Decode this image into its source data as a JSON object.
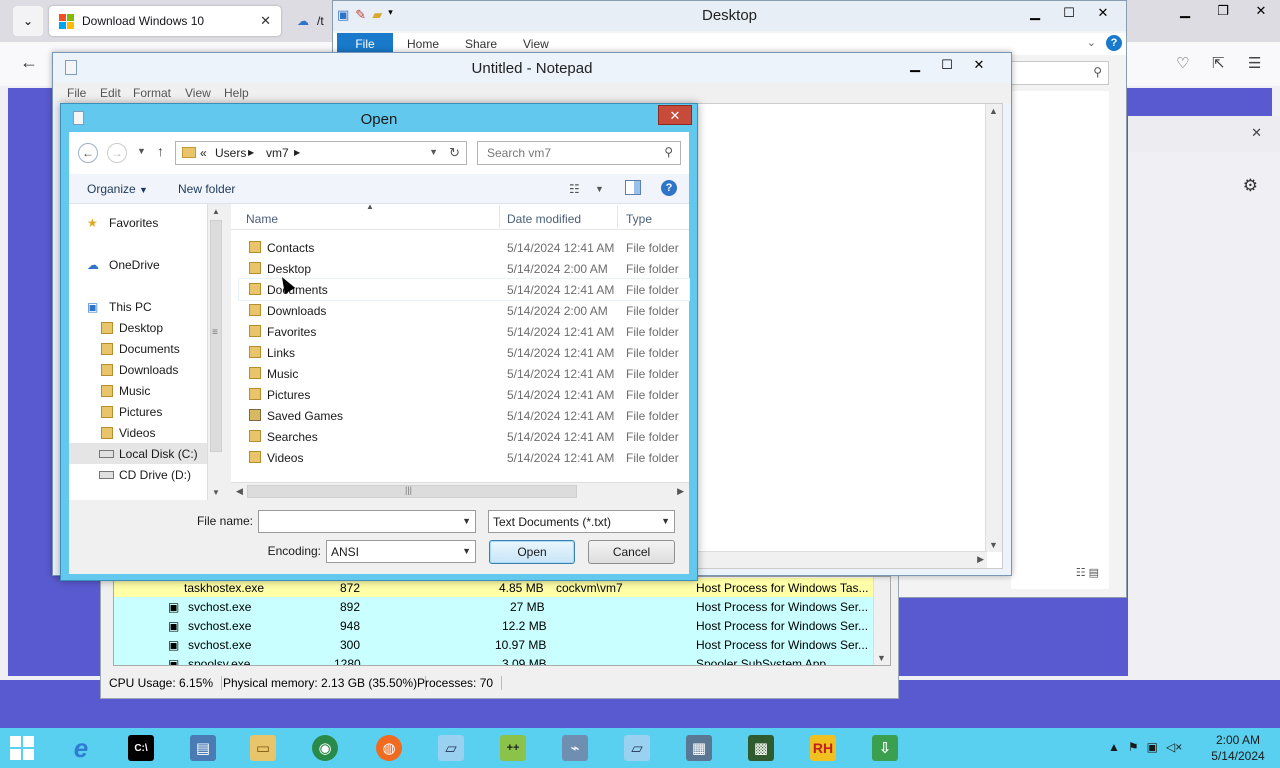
{
  "browser": {
    "active_tab": "Download Windows 10",
    "second_tab": "/t",
    "colors": {
      "accent": "#5a5ad0"
    }
  },
  "explorer": {
    "title": "Desktop",
    "ribbon_tabs": [
      "File",
      "Home",
      "Share",
      "View"
    ]
  },
  "notepad": {
    "title": "Untitled - Notepad",
    "menu": [
      "File",
      "Edit",
      "Format",
      "View",
      "Help"
    ]
  },
  "taskmgr": {
    "rows": [
      {
        "name": "taskhostex.exe",
        "pid": "872",
        "mem": "4.85 MB",
        "user": "cockvm\\vm7",
        "desc": "Host Process for Windows Tas..."
      },
      {
        "name": "svchost.exe",
        "pid": "892",
        "mem": "27 MB",
        "user": "",
        "desc": "Host Process for Windows Ser..."
      },
      {
        "name": "svchost.exe",
        "pid": "948",
        "mem": "12.2 MB",
        "user": "",
        "desc": "Host Process for Windows Ser..."
      },
      {
        "name": "svchost.exe",
        "pid": "300",
        "mem": "10.97 MB",
        "user": "",
        "desc": "Host Process for Windows Ser..."
      },
      {
        "name": "spoolsv.exe",
        "pid": "1280",
        "mem": "3.09 MB",
        "user": "",
        "desc": "Spooler SubSystem App"
      }
    ],
    "status": {
      "cpu": "CPU Usage: 6.15%",
      "memory": "Physical memory: 2.13 GB (35.50%)",
      "processes": "Processes: 70"
    }
  },
  "dialog": {
    "title": "Open",
    "address": {
      "prefix": "«",
      "crumbs": [
        "Users",
        "vm7"
      ]
    },
    "search_placeholder": "Search vm7",
    "toolbar": {
      "organize": "Organize",
      "new_folder": "New folder"
    },
    "nav": {
      "favorites": "Favorites",
      "onedrive": "OneDrive",
      "this_pc": "This PC",
      "items": [
        "Desktop",
        "Documents",
        "Downloads",
        "Music",
        "Pictures",
        "Videos"
      ],
      "drives": [
        "Local Disk (C:)",
        "CD Drive (D:)"
      ]
    },
    "columns": {
      "name": "Name",
      "date": "Date modified",
      "type": "Type"
    },
    "files": [
      {
        "name": "Contacts",
        "date": "5/14/2024 12:41 AM",
        "type": "File folder"
      },
      {
        "name": "Desktop",
        "date": "5/14/2024 2:00 AM",
        "type": "File folder"
      },
      {
        "name": "Documents",
        "date": "5/14/2024 12:41 AM",
        "type": "File folder"
      },
      {
        "name": "Downloads",
        "date": "5/14/2024 2:00 AM",
        "type": "File folder"
      },
      {
        "name": "Favorites",
        "date": "5/14/2024 12:41 AM",
        "type": "File folder"
      },
      {
        "name": "Links",
        "date": "5/14/2024 12:41 AM",
        "type": "File folder"
      },
      {
        "name": "Music",
        "date": "5/14/2024 12:41 AM",
        "type": "File folder"
      },
      {
        "name": "Pictures",
        "date": "5/14/2024 12:41 AM",
        "type": "File folder"
      },
      {
        "name": "Saved Games",
        "date": "5/14/2024 12:41 AM",
        "type": "File folder"
      },
      {
        "name": "Searches",
        "date": "5/14/2024 12:41 AM",
        "type": "File folder"
      },
      {
        "name": "Videos",
        "date": "5/14/2024 12:41 AM",
        "type": "File folder"
      }
    ],
    "file_name_label": "File name:",
    "file_name_value": "",
    "file_type": "Text Documents (*.txt)",
    "encoding_label": "Encoding:",
    "encoding_value": "ANSI",
    "open_button": "Open",
    "cancel_button": "Cancel"
  },
  "taskbar": {
    "apps": [
      "internet-explorer",
      "command-prompt",
      "server-manager",
      "file-explorer",
      "chrome",
      "firefox",
      "notepad",
      "notepad-plus-plus",
      "performance-monitor",
      "notepad-2",
      "app-window",
      "terminal",
      "rh",
      "download-manager"
    ],
    "clock_time": "2:00 AM",
    "clock_date": "5/14/2024"
  }
}
